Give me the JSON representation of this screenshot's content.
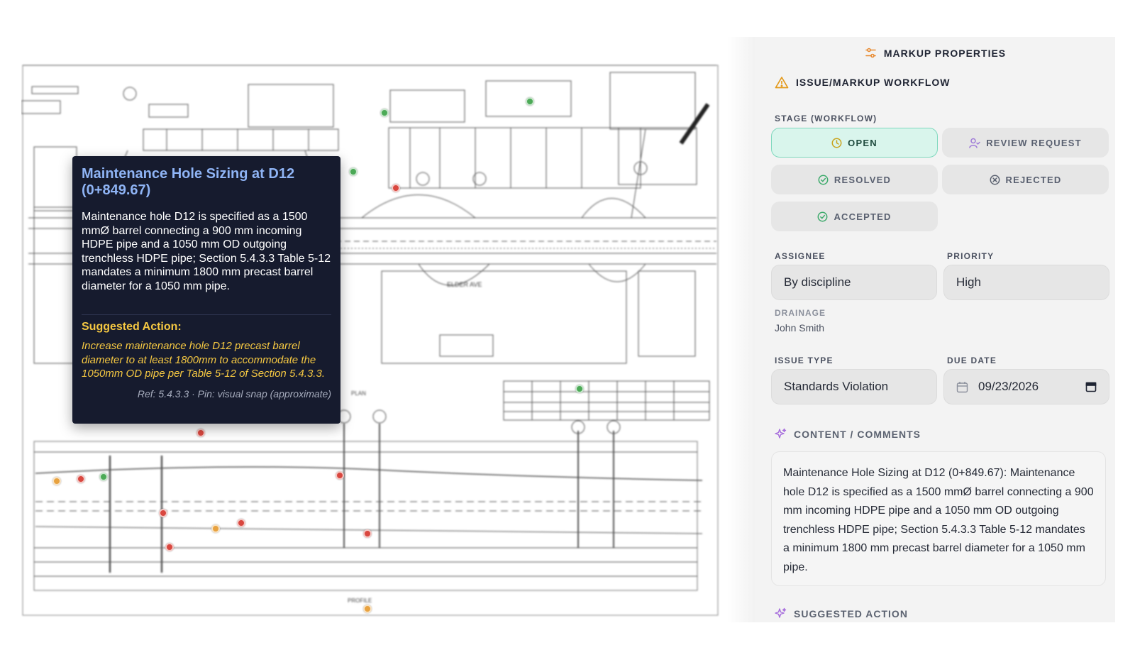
{
  "panel": {
    "header_title": "MARKUP PROPERTIES",
    "workflow_title": "ISSUE/MARKUP WORKFLOW",
    "stage_label": "STAGE (WORKFLOW)",
    "stages": [
      {
        "label": "OPEN",
        "icon": "clock-icon",
        "active": true
      },
      {
        "label": "REVIEW REQUEST",
        "icon": "user-check-icon",
        "active": false
      },
      {
        "label": "RESOLVED",
        "icon": "check-circle-icon",
        "active": false
      },
      {
        "label": "REJECTED",
        "icon": "x-circle-icon",
        "active": false
      },
      {
        "label": "ACCEPTED",
        "icon": "check-circle-icon",
        "active": false
      }
    ],
    "assignee_label": "ASSIGNEE",
    "assignee_value": "By discipline",
    "priority_label": "PRIORITY",
    "priority_value": "High",
    "discipline_label": "DRAINAGE",
    "discipline_person": "John Smith",
    "issue_type_label": "ISSUE TYPE",
    "issue_type_value": "Standards Violation",
    "due_date_label": "DUE DATE",
    "due_date_value": "09/23/2026",
    "content_title": "CONTENT / COMMENTS",
    "content_text": "Maintenance Hole Sizing at D12 (0+849.67): Maintenance hole D12 is specified as a 1500 mmØ barrel connecting a 900 mm incoming HDPE pipe and a 1050 mm OD outgoing trenchless HDPE pipe; Section 5.4.3.3 Table 5-12 mandates a minimum 1800 mm precast barrel diameter for a 1050 mm pipe.",
    "suggested_title": "SUGGESTED ACTION"
  },
  "tooltip": {
    "title": "Maintenance Hole Sizing at D12 (0+849.67)",
    "body": "Maintenance hole D12 is specified as a 1500 mmØ barrel connecting a 900 mm incoming HDPE pipe and a 1050 mm OD outgoing trenchless HDPE pipe; Section 5.4.3.3 Table 5-12 mandates a minimum 1800 mm precast barrel diameter for a 1050 mm pipe.",
    "action_heading": "Suggested Action:",
    "action_text": "Increase maintenance hole D12 precast barrel diameter to at least 1800mm to accommodate the 1050mm OD pipe per Table 5-12 of Section 5.4.3.3.",
    "reference": "Ref: 5.4.3.3 · Pin: visual snap (approximate)"
  },
  "drawing": {
    "label_elder": "ELDER AVE",
    "label_plan": "PLAN",
    "label_profile": "PROFILE"
  },
  "colors": {
    "accent_orange": "#e8892e",
    "warning_amber": "#e39a1b",
    "sparkle_purple": "#a56bdc",
    "active_stage_bg": "#d9f5ec",
    "active_stage_border": "#7ed8bd",
    "tooltip_bg": "#161b2e",
    "tooltip_title": "#8fb4f5",
    "tooltip_action": "#f5c842",
    "pin_red": "#d9473f",
    "pin_green": "#4caa57",
    "pin_orange": "#e8a23f"
  }
}
